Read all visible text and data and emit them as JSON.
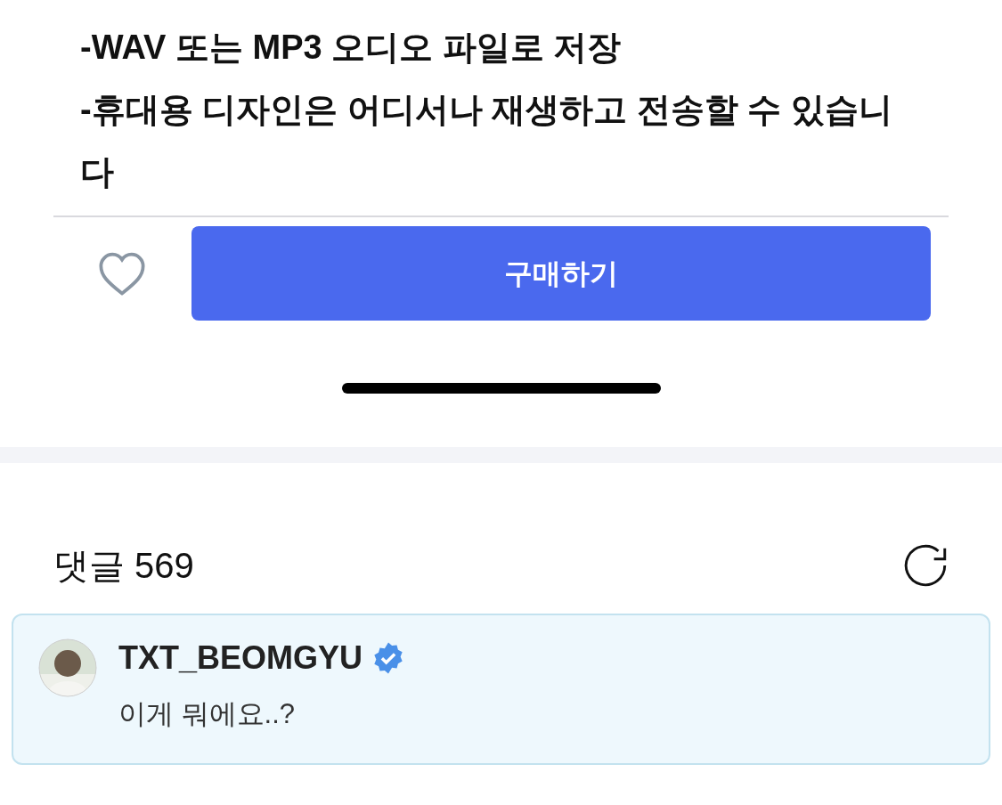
{
  "description": {
    "lines": [
      "-WAV 또는 MP3 오디오 파일로 저장",
      "-휴대용 디자인은 어디서나 재생하고 전송할 수 있습니다"
    ]
  },
  "purchase_bar": {
    "liked": false,
    "buy_button": "구매하기"
  },
  "comments": {
    "title": "댓글 569",
    "items": [
      {
        "author": "TXT_BEOMGYU",
        "verified": true,
        "highlighted": true,
        "text": "이게 뭐에요..?"
      }
    ]
  }
}
